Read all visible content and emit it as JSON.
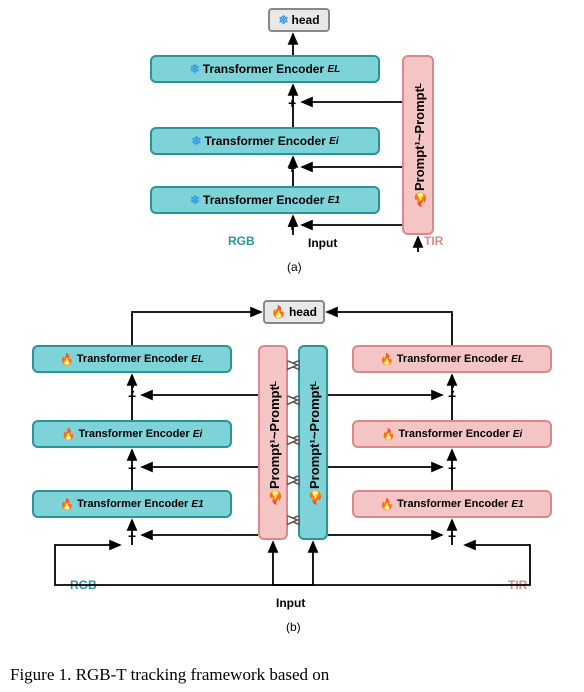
{
  "a": {
    "head": "head",
    "encL": "Transformer Encoder",
    "encL_sup": "E",
    "encL_idx": "L",
    "encI": "Transformer Encoder",
    "encI_sup": "E",
    "encI_idx": "i",
    "enc1": "Transformer Encoder",
    "enc1_sup": "E",
    "enc1_idx": "1",
    "prompt": "Prompt¹~Promptᴸ",
    "rgb": "RGB",
    "tir": "TIR",
    "input": "Input",
    "label": "(a)"
  },
  "b": {
    "head": "head",
    "left": {
      "encL": "Transformer Encoder",
      "encL_sup": "E",
      "encL_idx": "L",
      "encI": "Transformer Encoder",
      "encI_sup": "E",
      "encI_idx": "i",
      "enc1": "Transformer Encoder",
      "enc1_sup": "E",
      "enc1_idx": "1"
    },
    "right": {
      "encL": "Transformer Encoder",
      "encL_sup": "E",
      "encL_idx": "L",
      "encI": "Transformer Encoder",
      "encI_sup": "E",
      "encI_idx": "i",
      "enc1": "Transformer Encoder",
      "enc1_sup": "E",
      "enc1_idx": "1"
    },
    "promptL": "Prompt¹~Promptᴸ",
    "promptR": "Prompt¹~Promptᴸ",
    "rgb": "RGB",
    "tir": "TIR",
    "input": "Input",
    "label": "(b)"
  },
  "caption": "Figure 1. RGB-T tracking framework based on",
  "chart_data": {
    "type": "diagram",
    "description": "Two architecture diagrams (a) and (b) for RGB-T tracking",
    "diagram_a": {
      "frozen": [
        "head",
        "Transformer Encoder E^L",
        "Transformer Encoder E^i",
        "Transformer Encoder E^1"
      ],
      "trainable": [
        "Prompt^1~Prompt^L"
      ],
      "inputs": [
        "RGB",
        "TIR"
      ],
      "connections": [
        "RGB + Prompt -> E^1",
        "E^1 + Prompt -> E^i",
        "E^i + Prompt -> E^L",
        "E^L -> head",
        "TIR -> Prompt"
      ]
    },
    "diagram_b": {
      "frozen": [],
      "trainable": [
        "head",
        "left:Transformer Encoder E^L",
        "left:Transformer Encoder E^i",
        "left:Transformer Encoder E^1",
        "right:Transformer Encoder E^L",
        "right:Transformer Encoder E^i",
        "right:Transformer Encoder E^1",
        "Prompt^1~Prompt^L (left)",
        "Prompt^1~Prompt^L (right)"
      ],
      "inputs": [
        "RGB",
        "TIR"
      ],
      "connections": [
        "RGB -> left E^1",
        "left E^1 -> left E^i -> left E^L -> head",
        "TIR -> right E^1",
        "right E^1 -> right E^i -> right E^L -> head",
        "RGB -> right Prompt",
        "TIR -> left Prompt",
        "left Prompt <-> right Prompt (bidirectional at each layer)",
        "left Prompt -> left encoders (each layer)",
        "right Prompt -> right encoders (each layer)"
      ]
    }
  }
}
